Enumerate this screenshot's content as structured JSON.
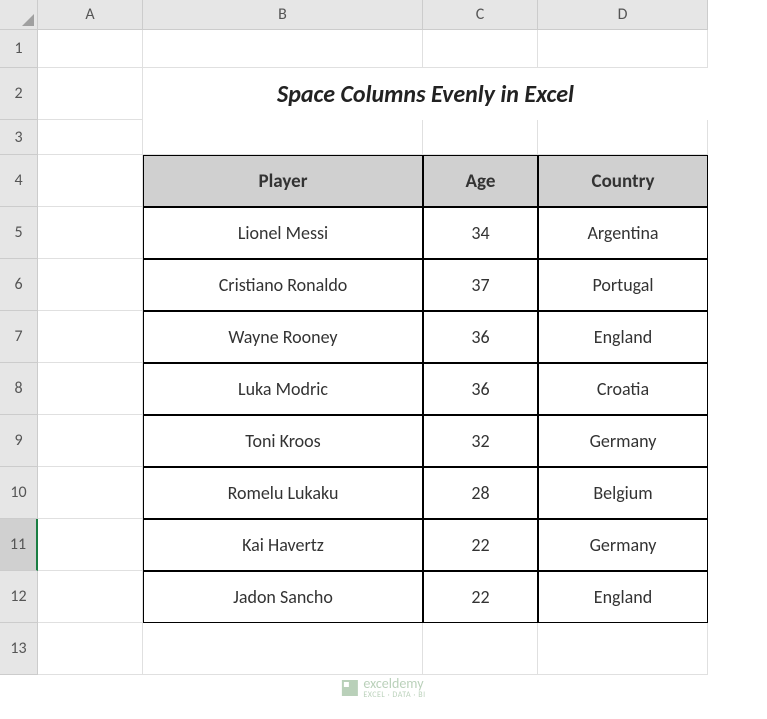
{
  "columns": [
    "A",
    "B",
    "C",
    "D"
  ],
  "rows": [
    "1",
    "2",
    "3",
    "4",
    "5",
    "6",
    "7",
    "8",
    "9",
    "10",
    "11",
    "12",
    "13"
  ],
  "selected_row": "11",
  "title": "Space Columns Evenly in Excel",
  "headers": {
    "player": "Player",
    "age": "Age",
    "country": "Country"
  },
  "data": [
    {
      "player": "Lionel Messi",
      "age": "34",
      "country": "Argentina"
    },
    {
      "player": "Cristiano Ronaldo",
      "age": "37",
      "country": "Portugal"
    },
    {
      "player": "Wayne Rooney",
      "age": "36",
      "country": "England"
    },
    {
      "player": "Luka Modric",
      "age": "36",
      "country": "Croatia"
    },
    {
      "player": "Toni Kroos",
      "age": "32",
      "country": "Germany"
    },
    {
      "player": "Romelu Lukaku",
      "age": "28",
      "country": "Belgium"
    },
    {
      "player": "Kai Havertz",
      "age": "22",
      "country": "Germany"
    },
    {
      "player": "Jadon Sancho",
      "age": "22",
      "country": "England"
    }
  ],
  "watermark": {
    "name": "exceldemy",
    "tagline": "EXCEL · DATA · BI"
  },
  "chart_data": {
    "type": "table",
    "title": "Space Columns Evenly in Excel",
    "columns": [
      "Player",
      "Age",
      "Country"
    ],
    "rows": [
      [
        "Lionel Messi",
        34,
        "Argentina"
      ],
      [
        "Cristiano Ronaldo",
        37,
        "Portugal"
      ],
      [
        "Wayne Rooney",
        36,
        "England"
      ],
      [
        "Luka Modric",
        36,
        "Croatia"
      ],
      [
        "Toni Kroos",
        32,
        "Germany"
      ],
      [
        "Romelu Lukaku",
        28,
        "Belgium"
      ],
      [
        "Kai Havertz",
        22,
        "Germany"
      ],
      [
        "Jadon Sancho",
        22,
        "England"
      ]
    ]
  }
}
